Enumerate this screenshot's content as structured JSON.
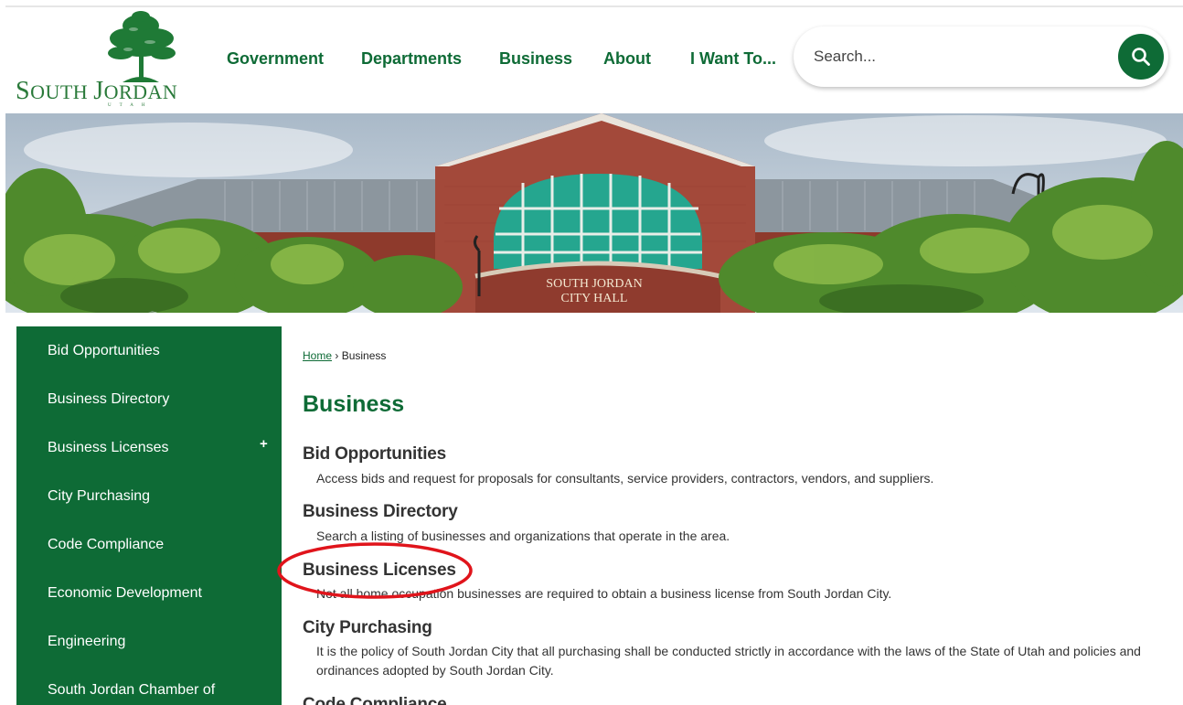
{
  "logo": {
    "text_first": "S",
    "text_outh": "OUTH ",
    "text_j": "J",
    "text_ordan": "ORDAN",
    "subtext": "UTAH",
    "icon": "tree-logo-icon"
  },
  "nav": {
    "items": [
      "Government",
      "Departments",
      "Business",
      "About",
      "I Want To..."
    ]
  },
  "search": {
    "placeholder": "Search...",
    "icon": "search-icon",
    "accent": "#0e6b36"
  },
  "banner": {
    "sign_line1": "SOUTH JORDAN",
    "sign_line2": "CITY HALL"
  },
  "sidebar": {
    "items": [
      {
        "label": "Bid Opportunities"
      },
      {
        "label": "Business Directory"
      },
      {
        "label": "Business Licenses",
        "expand": "+"
      },
      {
        "label": "City Purchasing"
      },
      {
        "label": "Code Compliance"
      },
      {
        "label": "Economic Development"
      },
      {
        "label": "Engineering"
      },
      {
        "label": "South Jordan Chamber of"
      }
    ]
  },
  "breadcrumb": {
    "home": "Home",
    "separator": "›",
    "current": "Business"
  },
  "main": {
    "title": "Business",
    "entries": [
      {
        "title": "Bid Opportunities",
        "desc": "Access bids and request for proposals for consultants, service providers, contractors, vendors, and suppliers."
      },
      {
        "title": "Business Directory",
        "desc": "Search a listing of businesses and organizations that operate in the area."
      },
      {
        "title": "Business Licenses",
        "desc": "Not all home occupation businesses are required to obtain a business license from South Jordan City."
      },
      {
        "title": "City Purchasing",
        "desc": "It is the policy of South Jordan City that all purchasing shall be conducted strictly in accordance with the laws of the State of Utah and policies and ordinances adopted by South Jordan City."
      },
      {
        "title": "Code Compliance"
      }
    ]
  },
  "colors": {
    "brand_green": "#0e6b36",
    "annotation_red": "#e0141b"
  }
}
